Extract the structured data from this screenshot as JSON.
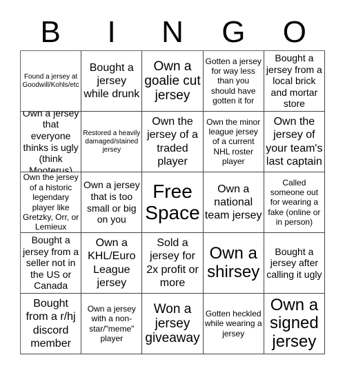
{
  "header": {
    "letters": [
      "B",
      "I",
      "N",
      "G",
      "O"
    ]
  },
  "cells": [
    [
      "Found a jersey at Goodwill/Kohls/etc",
      "Bought a jersey while drunk",
      "Own a goalie cut jersey",
      "Gotten a jersey for way less than you should have gotten it for",
      "Bought a jersey from a local brick and mortar store"
    ],
    [
      "Own a jersey that everyone thinks is ugly (think Mooterus)",
      "Restored a heavily damaged/stained jersey",
      "Own the jersey of a traded player",
      "Own the minor league jersey of a current NHL roster player",
      "Own the jersey of your team's last captain"
    ],
    [
      "Own the jersey of a historic legendary player like Gretzky, Orr, or Lemieux",
      "Own a jersey that is too small or big on you",
      "Free Space",
      "Own a national team jersey",
      "Called someone out for wearing a fake (online or in person)"
    ],
    [
      "Bought a jersey from a seller not in the US or Canada",
      "Own a KHL/Euro League jersey",
      "Sold a jersey for 2x profit or more",
      "Own a shirsey",
      "Bought a jersey after calling it ugly"
    ],
    [
      "Bought from a r/hj discord member",
      "Own a jersey with a non-star/\"meme\" player",
      "Won a jersey giveaway",
      "Gotten heckled while wearing a jersey",
      "Own a signed jersey"
    ]
  ]
}
